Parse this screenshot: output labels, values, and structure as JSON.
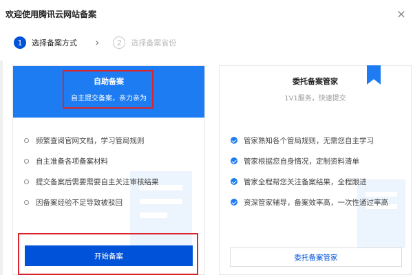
{
  "dialog": {
    "title": "欢迎使用腾讯云网站备案",
    "close_glyph": "×"
  },
  "steps": [
    {
      "number": "1",
      "label": "选择备案方式",
      "state": "active"
    },
    {
      "number": "2",
      "label": "选择备案省份",
      "state": "inactive"
    }
  ],
  "step_separator_glyph": "›",
  "self_service": {
    "title": "自助备案",
    "subtitle": "自主提交备案，亲力亲为",
    "features": [
      "频繁查阅官网文档，学习管局规则",
      "自主准备各项备案材料",
      "提交备案后需要需要自主关注审核结果",
      "因备案经验不足导致被驳回"
    ],
    "button_label": "开始备案"
  },
  "managed": {
    "title": "委托备案管家",
    "subtitle": "1V1服务，快速提交",
    "features": [
      "管家熟知各个管局规则，无需您自主学习",
      "管家根据您自身情况，定制资料清单",
      "管家全程帮您关注备案结果，全程跟进",
      "资深管家辅导，备案效率高，一次性通过率高"
    ],
    "button_label": "委托备案管家"
  },
  "colors": {
    "accent": "#0052d9",
    "header_blue": "#1d7cf2",
    "highlight_red": "#d9262e"
  }
}
